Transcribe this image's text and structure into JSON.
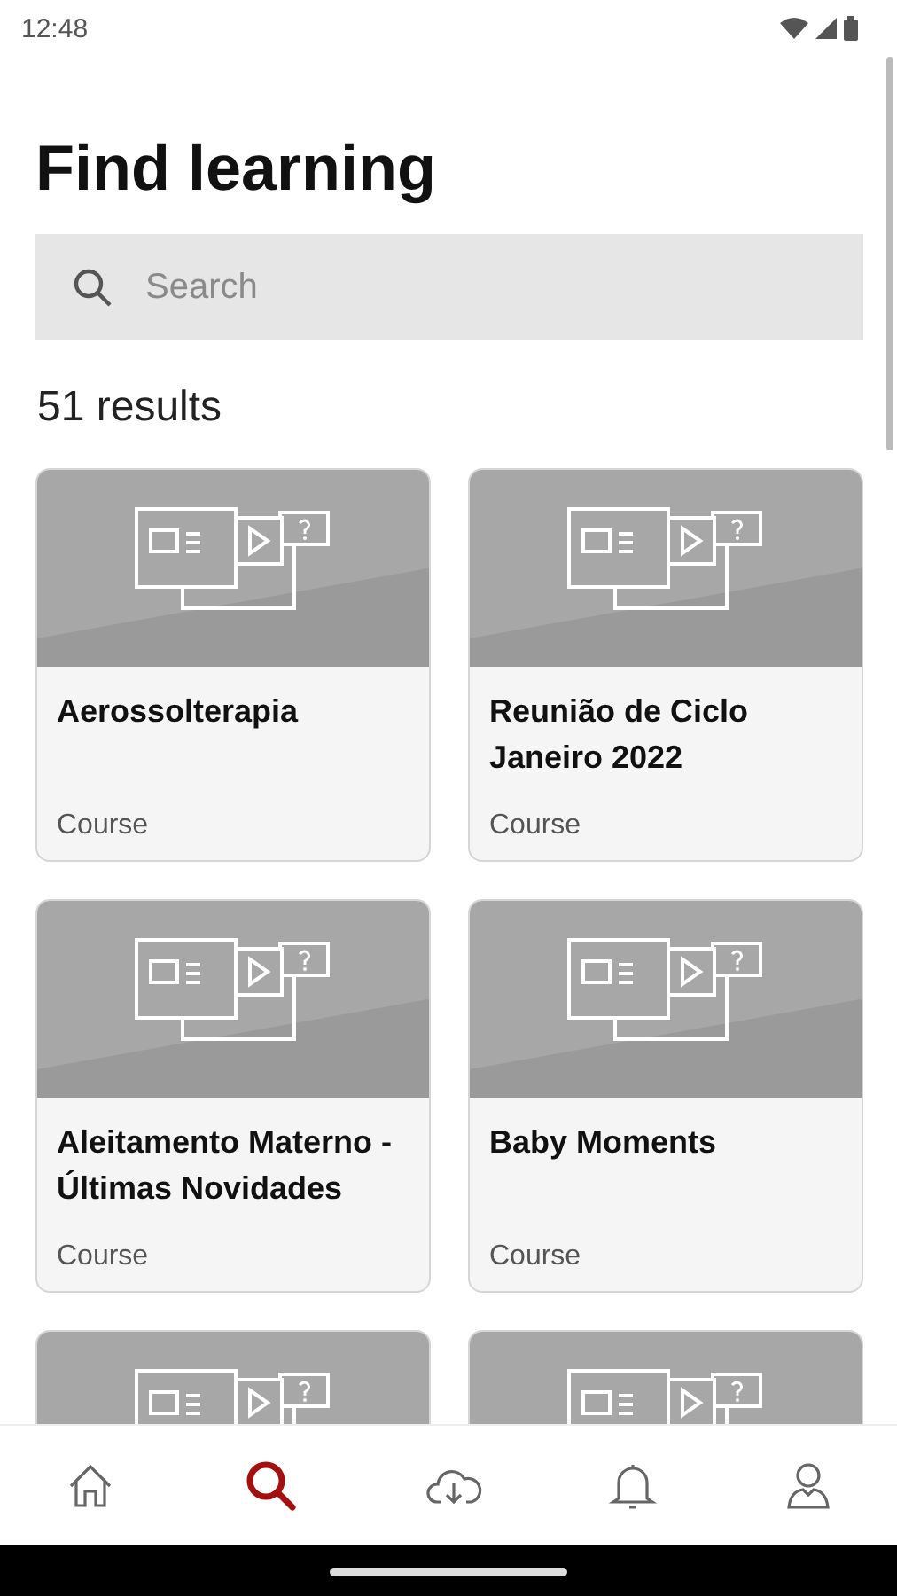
{
  "status_bar": {
    "time": "12:48"
  },
  "title": "Find learning",
  "search": {
    "placeholder": "Search"
  },
  "results_count": "51 results",
  "cards": [
    {
      "kind": "full",
      "title": "Aerossolterapia",
      "type": "Course"
    },
    {
      "kind": "full",
      "title": "Reunião de Ciclo Janeiro 2022",
      "type": "Course"
    },
    {
      "kind": "full",
      "title": "Aleitamento Materno - Últimas Novidades",
      "type": "Course"
    },
    {
      "kind": "full",
      "title": "Baby Moments",
      "type": "Course"
    },
    {
      "kind": "partial"
    },
    {
      "kind": "partial"
    }
  ],
  "bottom_nav": [
    {
      "kind": "home",
      "selected": false
    },
    {
      "kind": "search",
      "selected": true
    },
    {
      "kind": "download",
      "selected": false
    },
    {
      "kind": "notifications",
      "selected": false
    },
    {
      "kind": "profile",
      "selected": false
    }
  ]
}
